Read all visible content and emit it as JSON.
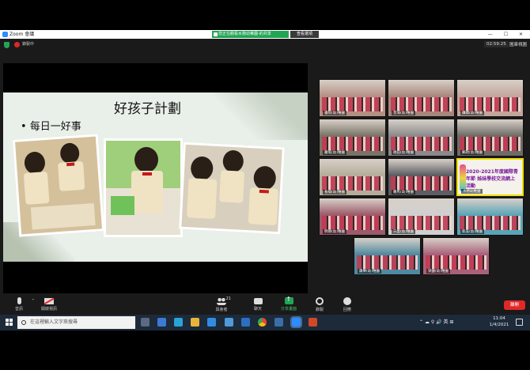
{
  "window": {
    "app_title": "Zoom 會議",
    "share_banner": "您正在觀看水務幼稚園-的共享",
    "view_options": "查看選項",
    "window_controls": "— ☐ ✕"
  },
  "status": {
    "label": "錄製中",
    "timer": "02:59:25",
    "gallery_view": "圖庫視圖"
  },
  "slide": {
    "title": "好孩子計劃",
    "bullet": "•   每日一好事"
  },
  "gallery": {
    "tiles": [
      {
        "name": "書院(幼)稚園",
        "color": "#b58f84"
      },
      {
        "name": "荃灣(幼)稚園",
        "color": "#a8867c"
      },
      {
        "name": "鑽蹟(幼)稚園",
        "color": "#c3a59c"
      },
      {
        "name": "麗瑤(幼)稚園",
        "color": "#7a7467"
      },
      {
        "name": "德田(幼)稚園",
        "color": "#8b8a8a"
      },
      {
        "name": "郵政(幼)稚園",
        "color": "#6f6b66"
      },
      {
        "name": "長福(幼)稚園",
        "color": "#b5ac9b"
      },
      {
        "name": "羅馬(幼)稚園",
        "color": "#5d5d63"
      },
      {
        "name": "水務幼稚園",
        "color": "#f4f2ea",
        "active": true,
        "poster": "2020-2021年度國際青年節 姊妹學校交流網上活動"
      },
      {
        "name": "明德(幼)稚園",
        "color": "#9c5a6a"
      },
      {
        "name": "三愛(幼)稚園",
        "color": "#d0d0d0"
      },
      {
        "name": "新美(幼)稚園",
        "color": "#5aa5b8"
      },
      {
        "name": "康樂(幼)稚園",
        "color": "#4f8aa0"
      },
      {
        "name": "梁園(幼)稚園",
        "color": "#a8617a"
      }
    ]
  },
  "toolbar": {
    "audio": "音訊",
    "video": "開啟視訊",
    "participants": "與會者",
    "participants_count": "21",
    "chat": "聊天",
    "share_screen": "分享畫面",
    "record": "錄製",
    "reactions": "回應",
    "leave": "離開"
  },
  "taskbar": {
    "search_placeholder": "在這裡輸入文字來搜尋",
    "tray": "⌃  ☁  ⚲  🔊  英  ⊞",
    "time": "11:04",
    "date": "1/4/2021"
  }
}
